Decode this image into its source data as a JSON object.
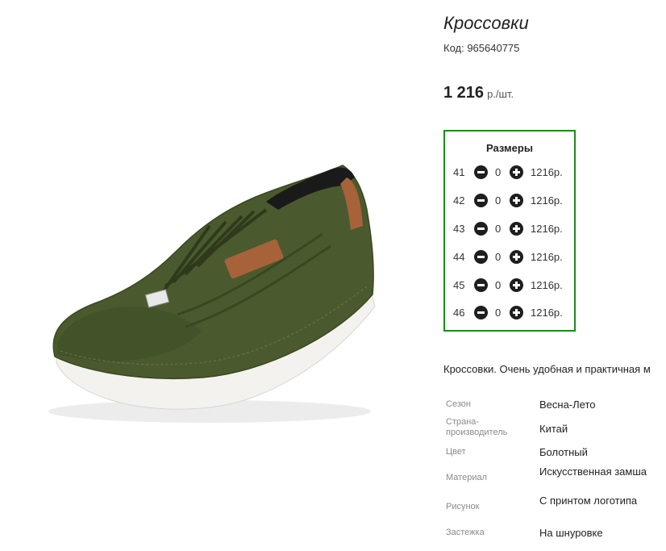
{
  "product": {
    "title": "Кроссовки",
    "code": "Код: 965640775",
    "price_amount": "1 216",
    "price_unit": "р./шт.",
    "description": "Кроссовки. Очень удобная и практичная м"
  },
  "sizes": {
    "title": "Размеры",
    "rows": [
      {
        "size": "41",
        "qty": "0",
        "price": "1216р."
      },
      {
        "size": "42",
        "qty": "0",
        "price": "1216р."
      },
      {
        "size": "43",
        "qty": "0",
        "price": "1216р."
      },
      {
        "size": "44",
        "qty": "0",
        "price": "1216р."
      },
      {
        "size": "45",
        "qty": "0",
        "price": "1216р."
      },
      {
        "size": "46",
        "qty": "0",
        "price": "1216р."
      }
    ]
  },
  "properties": [
    {
      "label": "Сезон",
      "value": "Весна-Лето"
    },
    {
      "label": "Страна-производитель",
      "value": "Китай"
    },
    {
      "label": "Цвет",
      "value": "Болотный"
    },
    {
      "label": "Материал",
      "value": "Искусственная замша"
    },
    {
      "label": "Рисунок",
      "value": "С принтом логотипа"
    },
    {
      "label": "Застежка",
      "value": "На шнуровке"
    }
  ],
  "product_image": {
    "icon": "sneaker-image",
    "colors": {
      "suede": "#4a5a2e",
      "sole": "#f4f2ee",
      "heel_tab": "#a8623a",
      "collar": "#1a1a1a",
      "border": "#1c8a1c"
    }
  }
}
